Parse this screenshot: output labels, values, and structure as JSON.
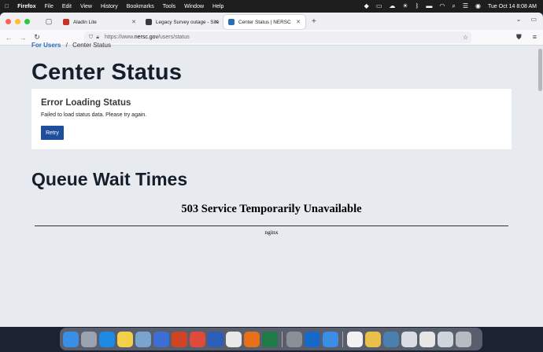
{
  "menubar": {
    "apple": "",
    "items": [
      "Firefox",
      "File",
      "Edit",
      "View",
      "History",
      "Bookmarks",
      "Tools",
      "Window",
      "Help"
    ],
    "datetime": "Tue Oct 14  8:08 AM"
  },
  "tabs": [
    {
      "label": "Aladin Lite",
      "favicon_color": "#c3342b"
    },
    {
      "label": "Legacy Survey outage - Site Fe",
      "favicon_color": "#3a3a3a"
    },
    {
      "label": "Center Status | NERSC",
      "favicon_color": "#2f6db3"
    }
  ],
  "url": {
    "prefix": "https://www.",
    "domain": "nersc.gov",
    "path": "/users/status"
  },
  "page": {
    "breadcrumb_parent": "For Users",
    "breadcrumb_sep": "/",
    "breadcrumb_current": "Center Status",
    "title": "Center Status",
    "error_title": "Error Loading Status",
    "error_message": "Failed to load status data. Please try again.",
    "retry_label": "Retry",
    "queue_heading": "Queue Wait Times",
    "server_error": "503 Service Temporarily Unavailable",
    "server_name": "nginx"
  },
  "colors": {
    "accent": "#1f4e9c",
    "page_bg": "#e7eaee",
    "link": "#2a6ebd"
  },
  "dock": [
    {
      "name": "finder-icon",
      "color": "#3a8ee6"
    },
    {
      "name": "launchpad-icon",
      "color": "#9aa3b0"
    },
    {
      "name": "safari-icon",
      "color": "#1e88e5"
    },
    {
      "name": "notes-icon",
      "color": "#f3d04a"
    },
    {
      "name": "preview-icon",
      "color": "#7aa4d0"
    },
    {
      "name": "keynote-icon",
      "color": "#3b6fd6"
    },
    {
      "name": "powerpoint-icon",
      "color": "#d04423"
    },
    {
      "name": "chrome-icon",
      "color": "#e04a3a"
    },
    {
      "name": "word-icon",
      "color": "#2b5eb8"
    },
    {
      "name": "textedit-icon",
      "color": "#e8e8e8"
    },
    {
      "name": "firefox-icon",
      "color": "#e8701a"
    },
    {
      "name": "excel-icon",
      "color": "#1f7a45"
    },
    {
      "name": "settings-icon",
      "color": "#8a8f98"
    },
    {
      "name": "outlook-icon",
      "color": "#1669c8"
    },
    {
      "name": "mail-icon",
      "color": "#3a8ee6"
    },
    {
      "name": "document-icon",
      "color": "#f2f2f2"
    },
    {
      "name": "photos-icon",
      "color": "#e9c04a"
    },
    {
      "name": "screenshot-icon",
      "color": "#4a7fb0"
    },
    {
      "name": "window-thumb-icon",
      "color": "#d9dde3"
    },
    {
      "name": "window-thumb-icon-2",
      "color": "#e6e6e6"
    },
    {
      "name": "window-thumb-icon-3",
      "color": "#cfd5dd"
    },
    {
      "name": "trash-icon",
      "color": "#b8bcc2"
    }
  ]
}
